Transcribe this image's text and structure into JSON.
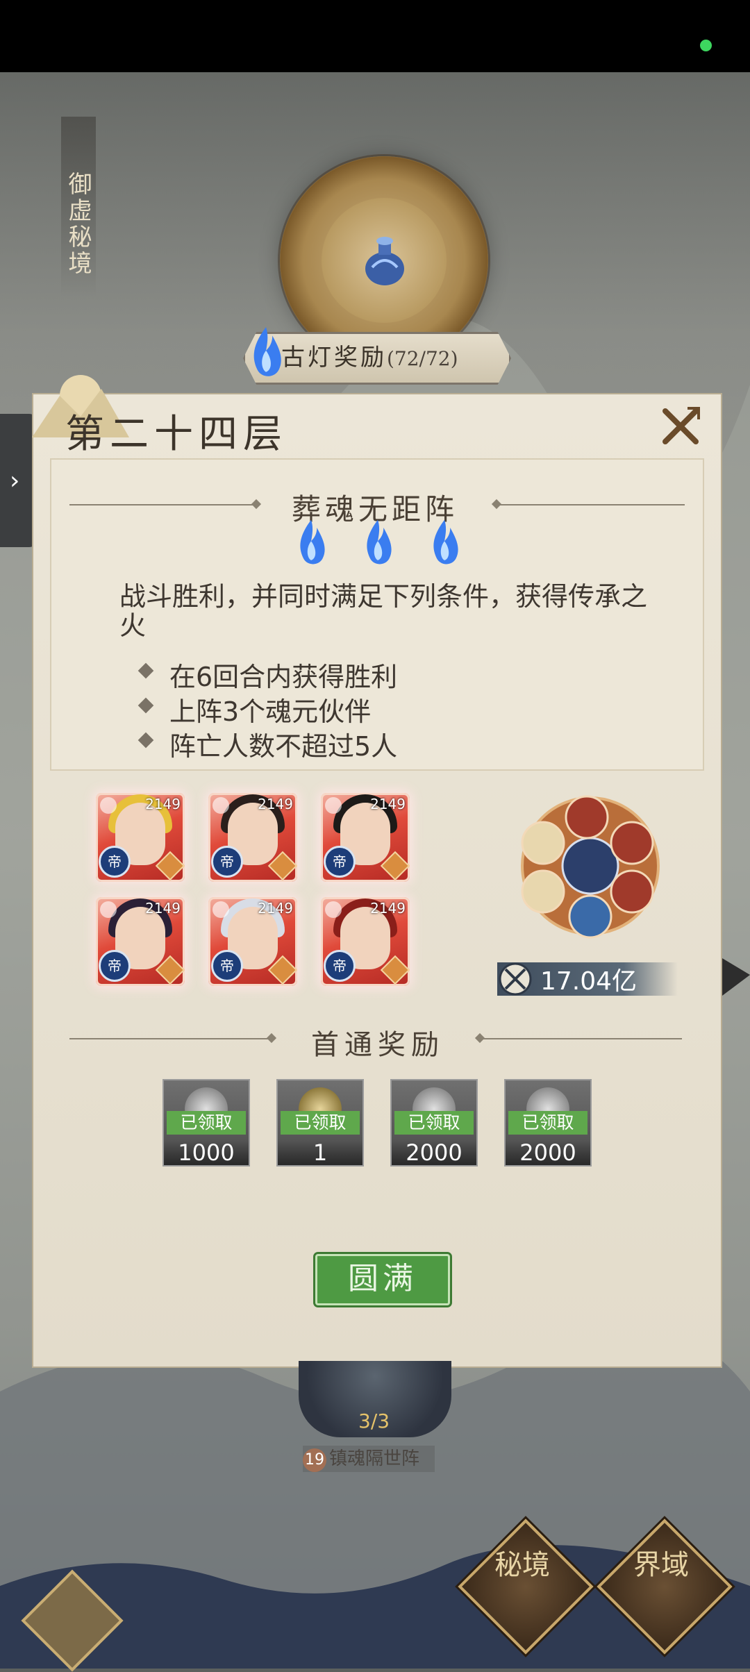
{
  "realm": {
    "title": "御虚秘境"
  },
  "lamp": {
    "label": "古灯奖励",
    "count": "(72/72)"
  },
  "floor": {
    "title": "第二十四层"
  },
  "challenge": {
    "name": "葬魂无距阵",
    "flames": 3,
    "description": "战斗胜利，并同时满足下列条件，获得传承之火",
    "conditions": [
      "在6回合内获得胜利",
      "上阵3个魂元伙伴",
      "阵亡人数不超过5人"
    ]
  },
  "team": {
    "heroes": [
      {
        "level": "2149",
        "badge": "帝"
      },
      {
        "level": "2149",
        "badge": "帝"
      },
      {
        "level": "2149",
        "badge": "帝"
      },
      {
        "level": "2149",
        "badge": "帝"
      },
      {
        "level": "2149",
        "badge": "帝"
      },
      {
        "level": "2149",
        "badge": "帝"
      }
    ],
    "power": "17.04亿"
  },
  "rewards": {
    "title": "首通奖励",
    "items": [
      {
        "status": "已领取",
        "qty": "1000"
      },
      {
        "status": "已领取",
        "qty": "1"
      },
      {
        "status": "已领取",
        "qty": "2000"
      },
      {
        "status": "已领取",
        "qty": "2000"
      }
    ]
  },
  "status_button": "圆满",
  "next_node": {
    "progress": "3/3",
    "level": "19",
    "name": "镇魂隔世阵"
  },
  "nav": {
    "secret": "秘境",
    "domain": "界域"
  },
  "colors": {
    "panel": "#ece6d8",
    "accent_green": "#4e9a43",
    "flame_blue": "#3a7df0",
    "hero_red": "#e04a3a"
  }
}
